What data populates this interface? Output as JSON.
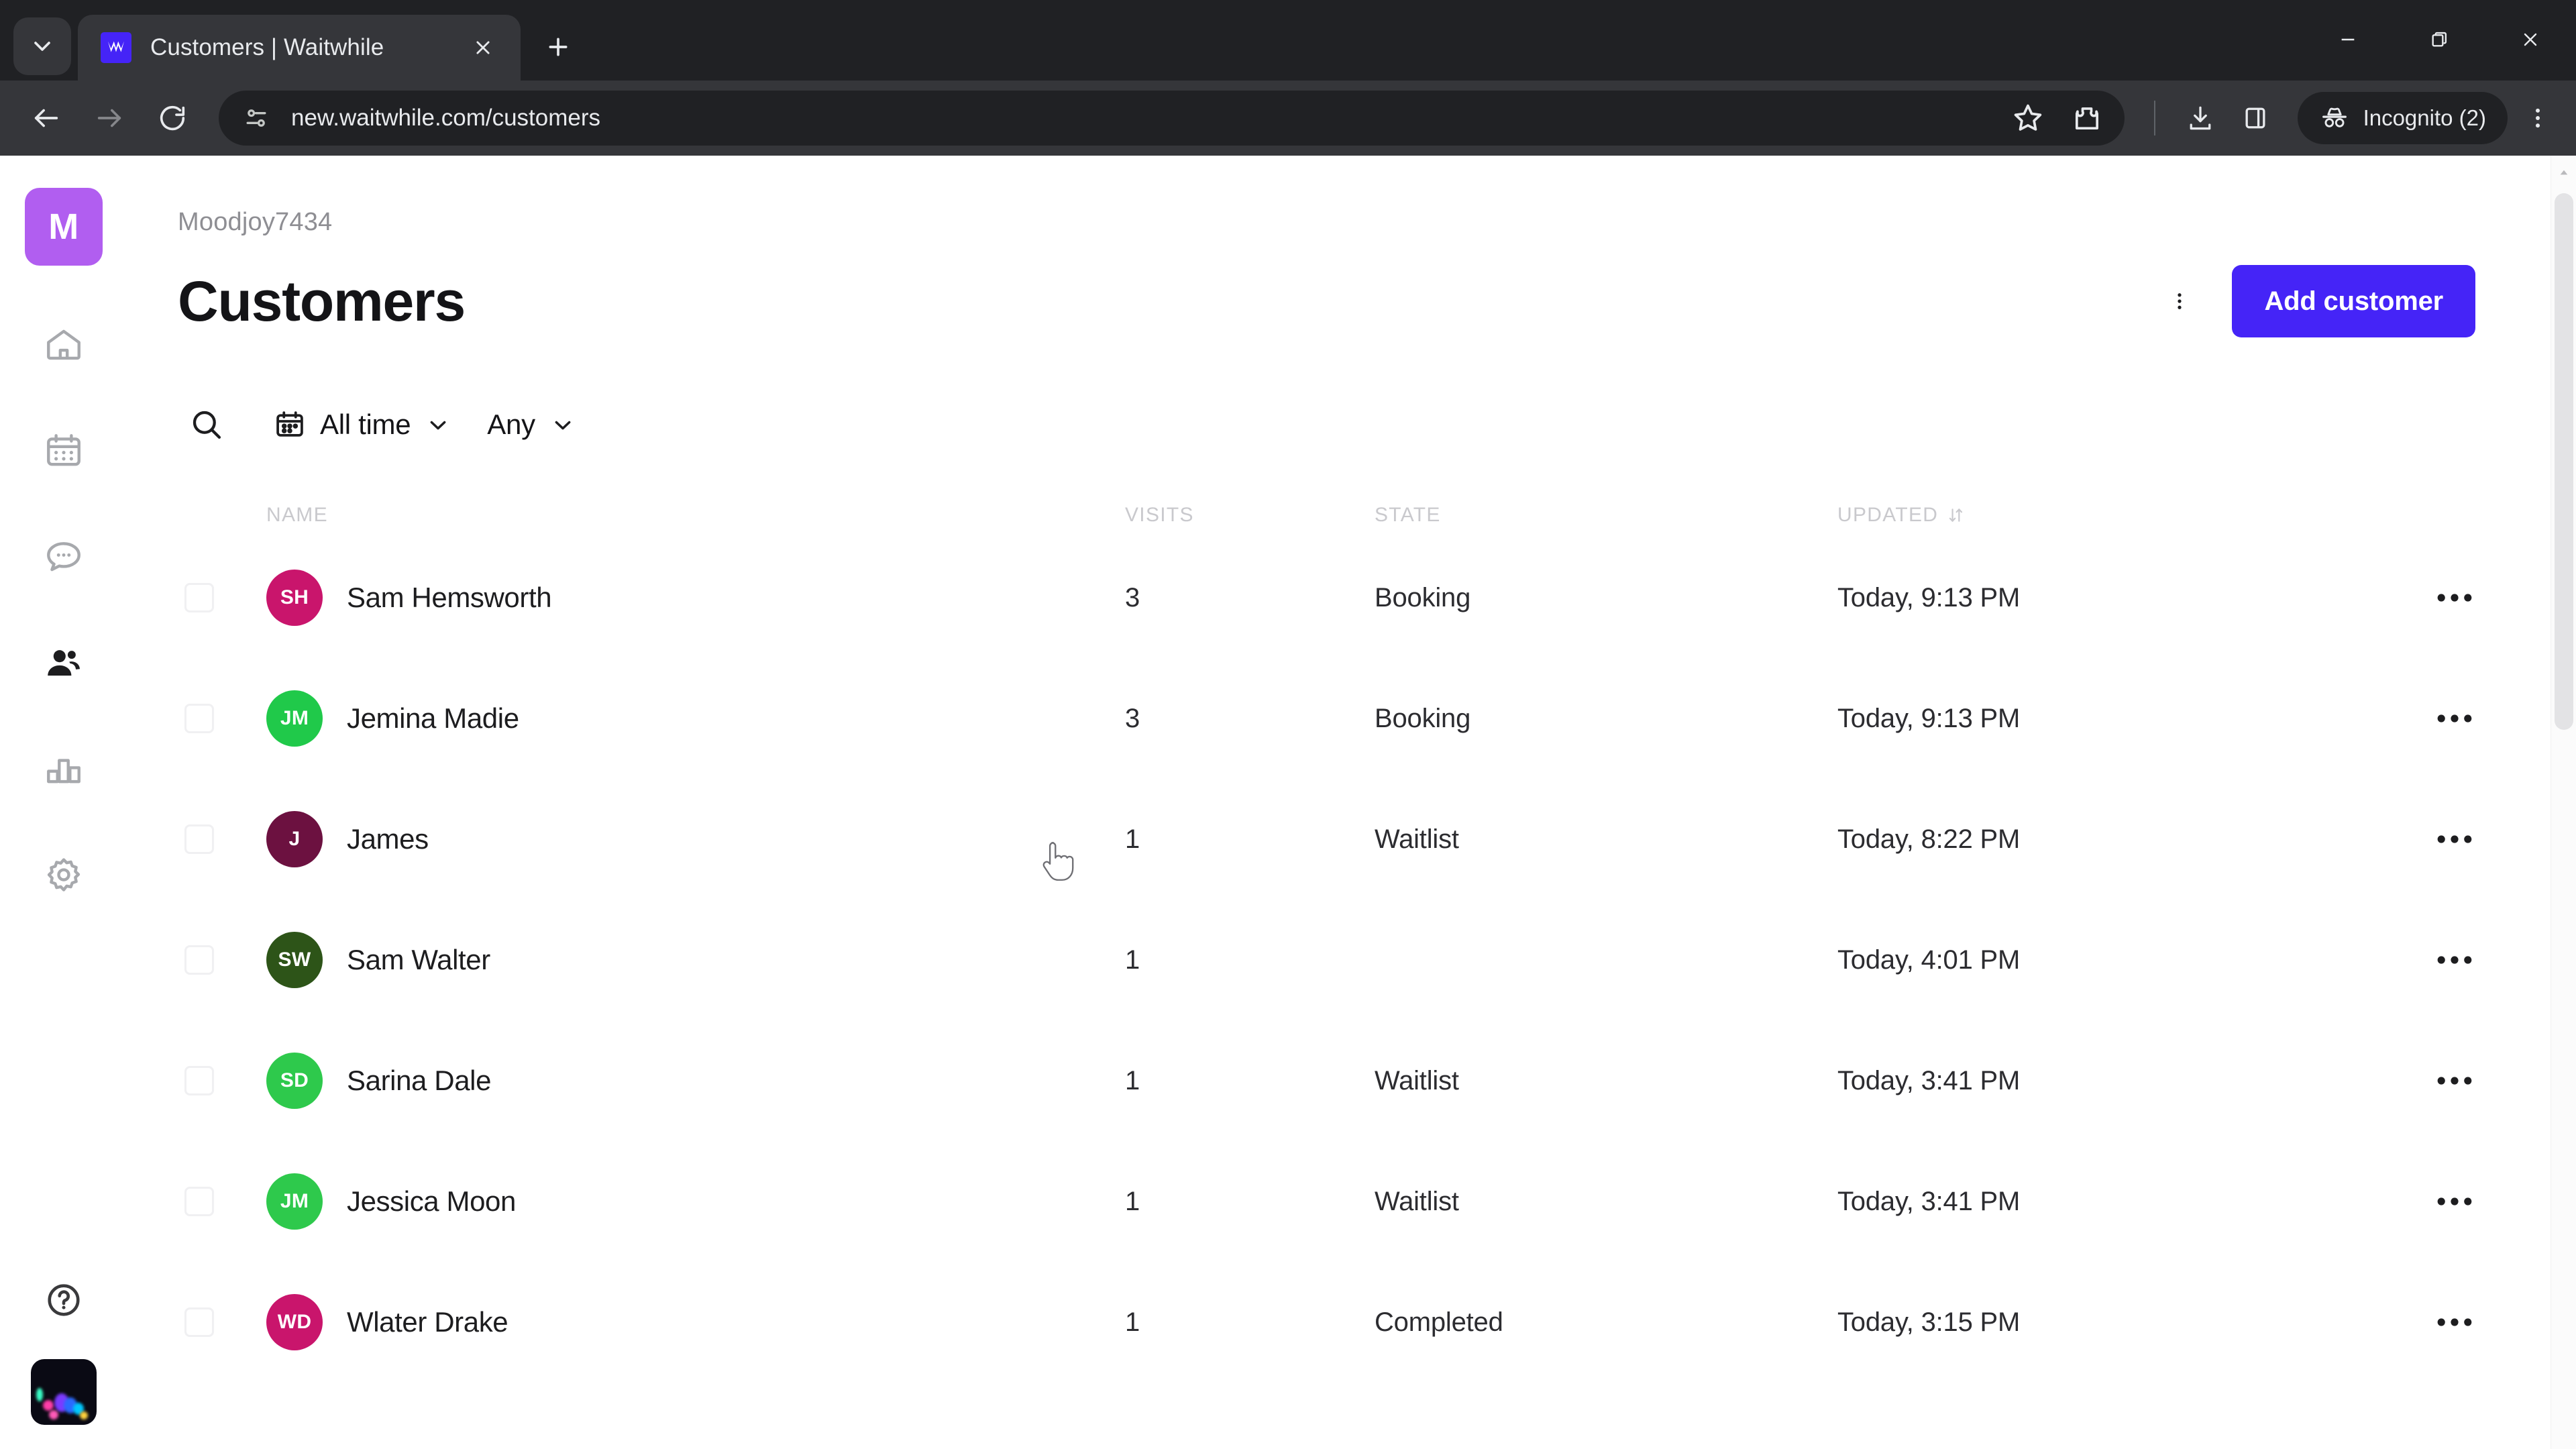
{
  "browser": {
    "tab": {
      "title": "Customers | Waitwhile",
      "favicon": "waitwhile-logo-icon",
      "close_icon": "close-icon"
    },
    "tab_search_icon": "chevron-down-icon",
    "new_tab_icon": "plus-icon",
    "window_controls": {
      "minimize": "minimize-icon",
      "maximize": "maximize-icon",
      "close": "close-icon"
    },
    "nav": {
      "back": "back-arrow-icon",
      "forward": "forward-arrow-icon",
      "reload": "reload-icon"
    },
    "omnibox": {
      "url": "new.waitwhile.com/customers",
      "site_info_icon": "page-settings-icon",
      "bookmark_icon": "star-icon",
      "extension_icon": "extensions-icon"
    },
    "toolbar": {
      "download_icon": "download-icon",
      "side_panel_icon": "side-panel-icon",
      "profile_label": "Incognito (2)",
      "profile_icon": "incognito-icon",
      "menu_icon": "three-dots-vertical-icon"
    }
  },
  "sidebar": {
    "logo": "M",
    "logo_color": "#b15ef0",
    "items": [
      {
        "name": "home",
        "icon": "home-icon",
        "active": false
      },
      {
        "name": "schedule",
        "icon": "calendar-icon",
        "active": false
      },
      {
        "name": "messages",
        "icon": "chat-bubble-icon",
        "active": false
      },
      {
        "name": "customers",
        "icon": "people-icon",
        "active": true
      },
      {
        "name": "analytics",
        "icon": "bar-chart-icon",
        "active": false
      },
      {
        "name": "settings",
        "icon": "gear-icon",
        "active": false
      }
    ],
    "help_icon": "question-circle-icon",
    "user_avatar": "user-photo-avatar"
  },
  "header": {
    "org_name": "Moodjoy7434",
    "page_title": "Customers",
    "kebab_icon": "three-dots-vertical-icon",
    "add_customer_label": "Add customer",
    "accent_color": "#4524f7"
  },
  "filters": {
    "search_icon": "search-icon",
    "date_filter": {
      "label": "All time",
      "icon": "calendar-icon",
      "chevron": "chevron-down-icon"
    },
    "state_filter": {
      "label": "Any",
      "chevron": "chevron-down-icon"
    }
  },
  "table": {
    "columns": [
      "NAME",
      "VISITS",
      "STATE",
      "UPDATED"
    ],
    "sort_column": "UPDATED",
    "sort_icon": "sort-descending-icon",
    "row_action_icon": "three-dots-horizontal-icon",
    "rows": [
      {
        "initials": "SH",
        "color": "#c9156c",
        "name": "Sam Hemsworth",
        "visits": "3",
        "state": "Booking",
        "updated": "Today, 9:13 PM"
      },
      {
        "initials": "JM",
        "color": "#20c94a",
        "name": "Jemina Madie",
        "visits": "3",
        "state": "Booking",
        "updated": "Today, 9:13 PM"
      },
      {
        "initials": "J",
        "color": "#6c1140",
        "name": "James",
        "visits": "1",
        "state": "Waitlist",
        "updated": "Today, 8:22 PM"
      },
      {
        "initials": "SW",
        "color": "#2d5418",
        "name": "Sam Walter",
        "visits": "1",
        "state": "",
        "updated": "Today, 4:01 PM"
      },
      {
        "initials": "SD",
        "color": "#2ec94c",
        "name": "Sarina Dale",
        "visits": "1",
        "state": "Waitlist",
        "updated": "Today, 3:41 PM"
      },
      {
        "initials": "JM",
        "color": "#2ec94c",
        "name": "Jessica Moon",
        "visits": "1",
        "state": "Waitlist",
        "updated": "Today, 3:41 PM"
      },
      {
        "initials": "WD",
        "color": "#c9156c",
        "name": "Wlater Drake",
        "visits": "1",
        "state": "Completed",
        "updated": "Today, 3:15 PM"
      }
    ]
  },
  "scrollbar": {
    "up_arrow_icon": "chevron-up-icon"
  },
  "cursor": {
    "icon": "pointing-hand-cursor"
  }
}
